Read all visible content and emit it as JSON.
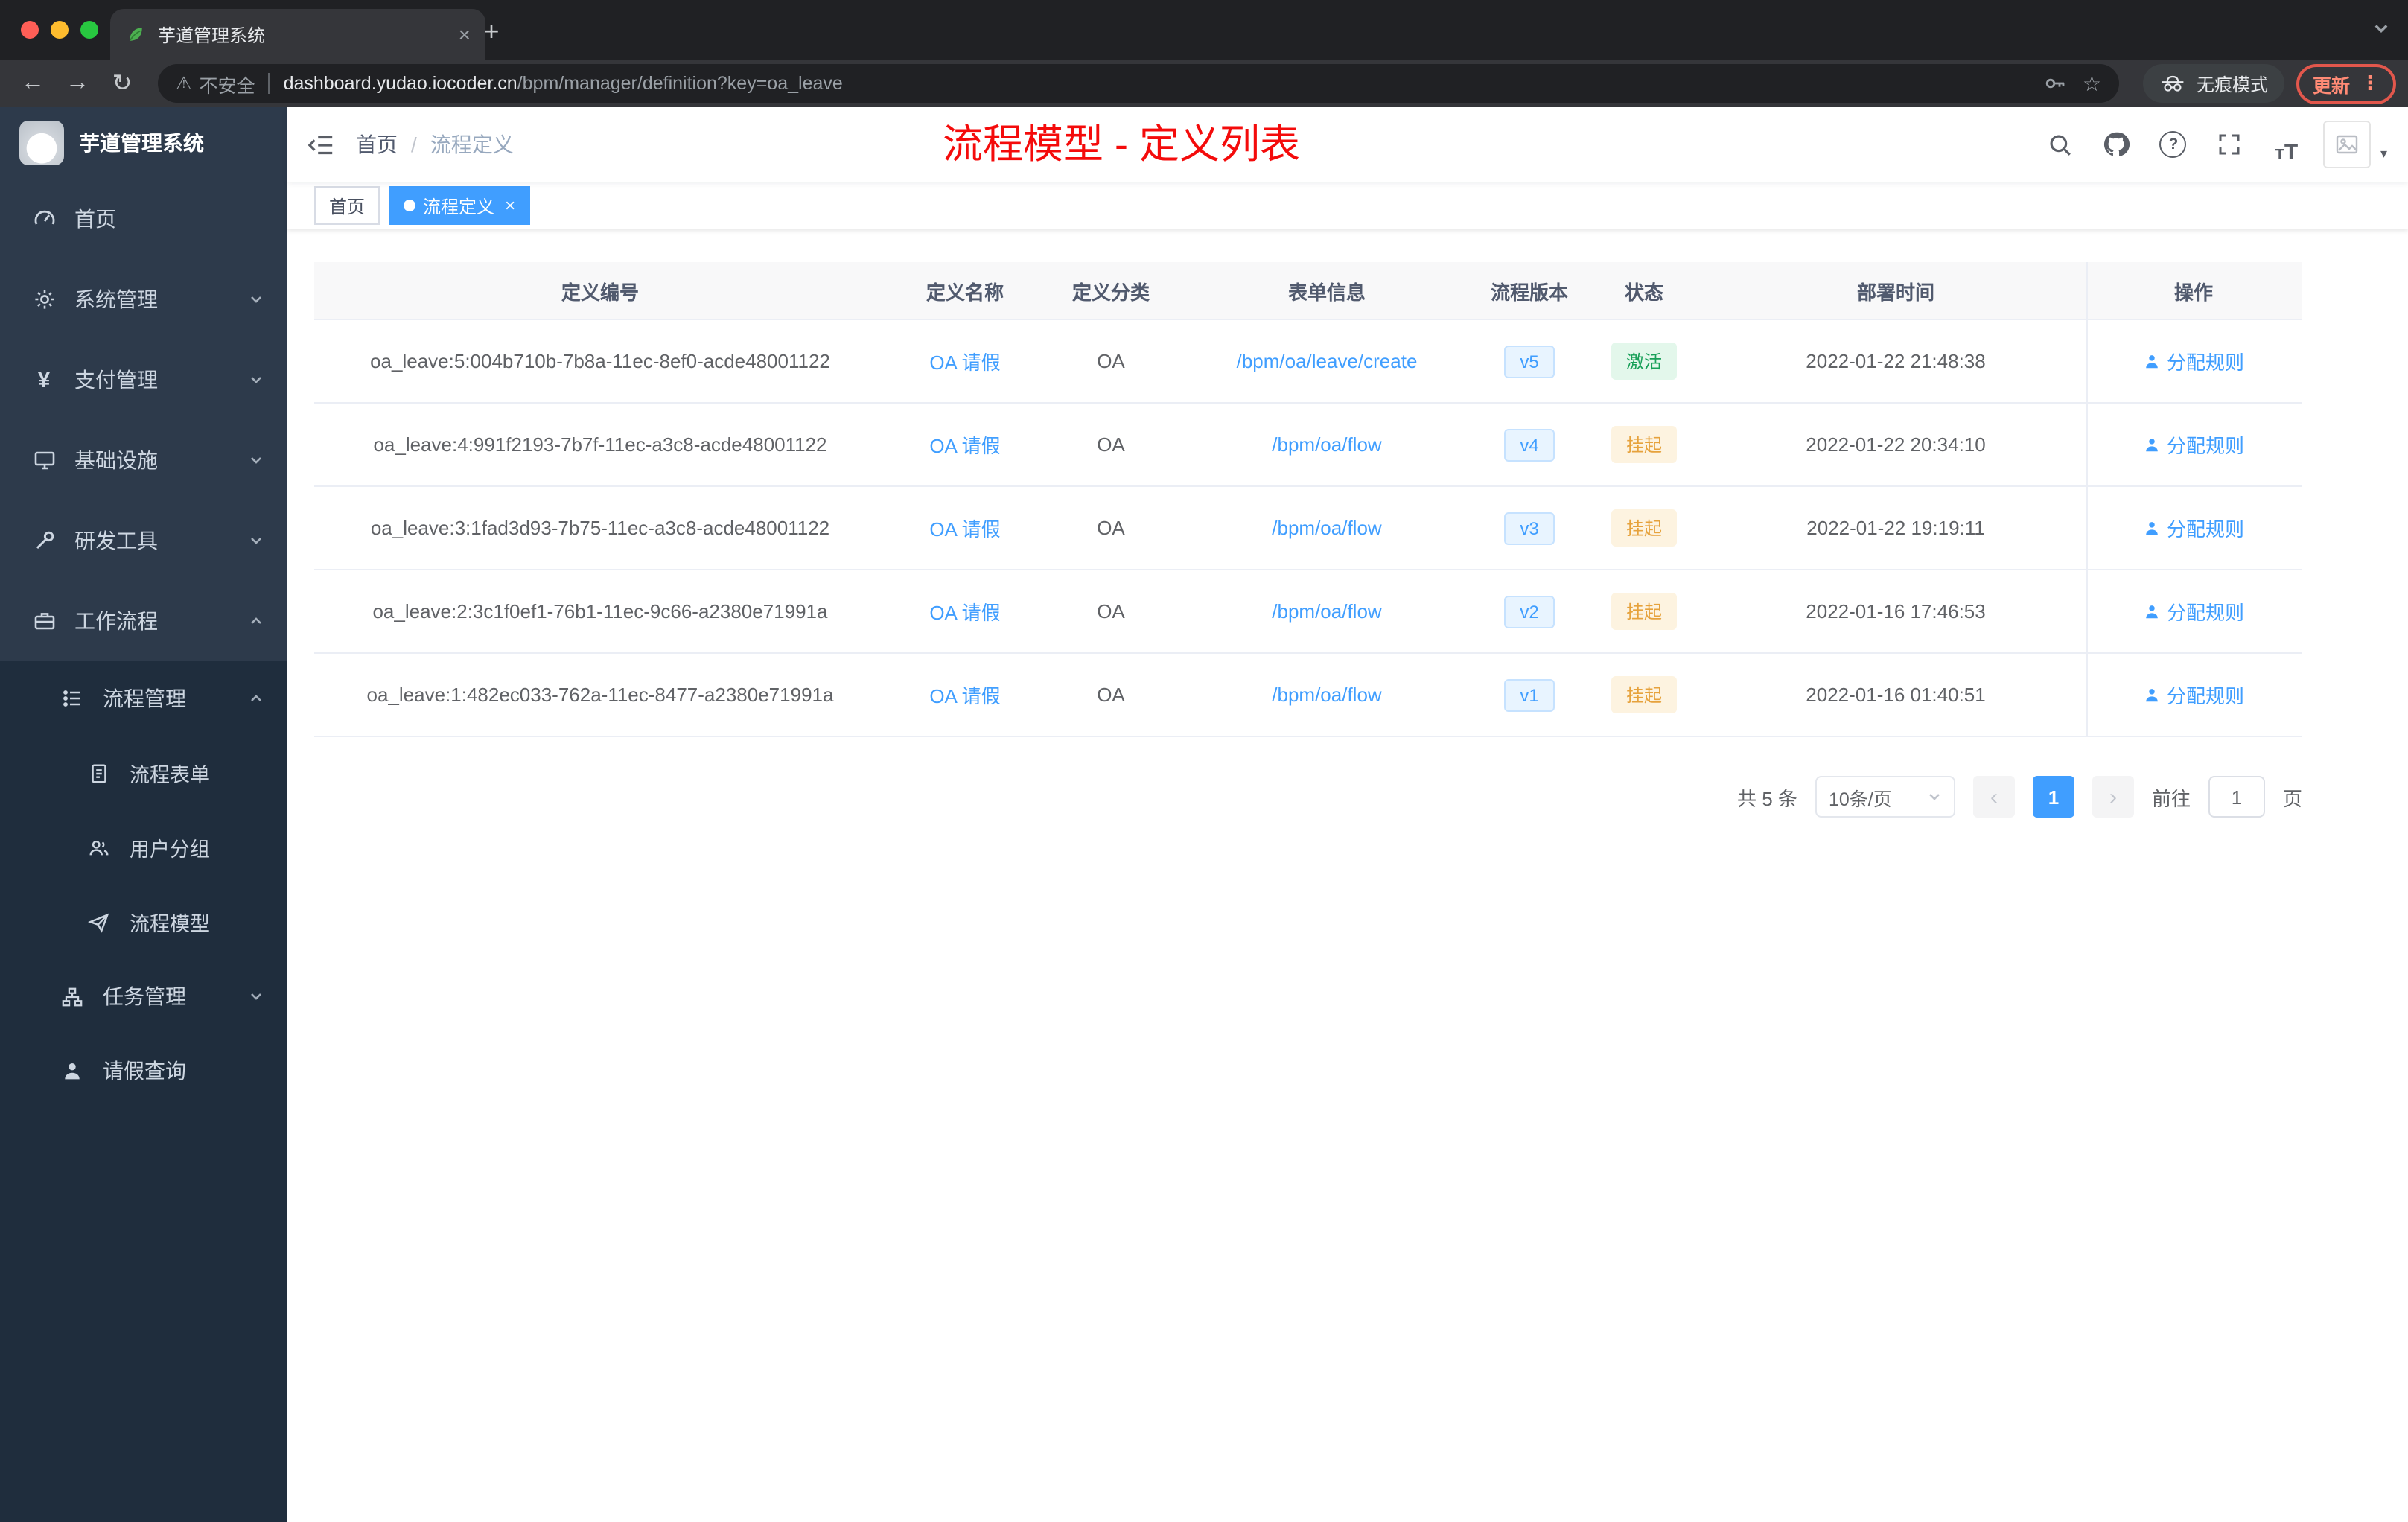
{
  "theme": {
    "accent": "#409eff",
    "annotation_red": "#f40b0b",
    "success_text": "#18a058",
    "success_bg": "#e3f7eb",
    "warning_text": "#e6a23c",
    "warning_bg": "#fdf3e0",
    "sidebar_bg": "#2d3a4b",
    "submenu_bg": "#1f2d3d",
    "tag_active": "#409eff"
  },
  "browser": {
    "tab_title": "芋道管理系统",
    "security_label": "不安全",
    "url_host": "dashboard.yudao.iocoder.cn",
    "url_path": "/bpm/manager/definition?key=oa_leave",
    "incognito_label": "无痕模式",
    "update_label": "更新"
  },
  "sidebar": {
    "logo_title": "芋道管理系统",
    "items": {
      "home": "首页",
      "system": "系统管理",
      "payment": "支付管理",
      "infra": "基础设施",
      "dev": "研发工具",
      "workflow": "工作流程",
      "process_mgmt": "流程管理",
      "process_form": "流程表单",
      "user_group": "用户分组",
      "process_model": "流程模型",
      "task_mgmt": "任务管理",
      "leave_query": "请假查询"
    }
  },
  "navbar": {
    "breadcrumb_home": "首页",
    "breadcrumb_separator": "/",
    "breadcrumb_current": "流程定义",
    "annotation": "流程模型 - 定义列表"
  },
  "tags": {
    "home": "首页",
    "active": "流程定义"
  },
  "table": {
    "columns": [
      "定义编号",
      "定义名称",
      "定义分类",
      "表单信息",
      "流程版本",
      "状态",
      "部署时间",
      "操作"
    ],
    "rows": [
      {
        "id": "oa_leave:5:004b710b-7b8a-11ec-8ef0-acde48001122",
        "name": "OA 请假",
        "category": "OA",
        "form": "/bpm/oa/leave/create",
        "version": "v5",
        "status": "激活",
        "status_type": "success",
        "time": "2022-01-22 21:48:38",
        "action": "分配规则"
      },
      {
        "id": "oa_leave:4:991f2193-7b7f-11ec-a3c8-acde48001122",
        "name": "OA 请假",
        "category": "OA",
        "form": "/bpm/oa/flow",
        "version": "v4",
        "status": "挂起",
        "status_type": "warning",
        "time": "2022-01-22 20:34:10",
        "action": "分配规则"
      },
      {
        "id": "oa_leave:3:1fad3d93-7b75-11ec-a3c8-acde48001122",
        "name": "OA 请假",
        "category": "OA",
        "form": "/bpm/oa/flow",
        "version": "v3",
        "status": "挂起",
        "status_type": "warning",
        "time": "2022-01-22 19:19:11",
        "action": "分配规则"
      },
      {
        "id": "oa_leave:2:3c1f0ef1-76b1-11ec-9c66-a2380e71991a",
        "name": "OA 请假",
        "category": "OA",
        "form": "/bpm/oa/flow",
        "version": "v2",
        "status": "挂起",
        "status_type": "warning",
        "time": "2022-01-16 17:46:53",
        "action": "分配规则"
      },
      {
        "id": "oa_leave:1:482ec033-762a-11ec-8477-a2380e71991a",
        "name": "OA 请假",
        "category": "OA",
        "form": "/bpm/oa/flow",
        "version": "v1",
        "status": "挂起",
        "status_type": "warning",
        "time": "2022-01-16 01:40:51",
        "action": "分配规则"
      }
    ]
  },
  "pagination": {
    "total": "共 5 条",
    "page_size": "10条/页",
    "page": "1",
    "goto_label": "前往",
    "goto_value": "1",
    "unit_label": "页"
  }
}
